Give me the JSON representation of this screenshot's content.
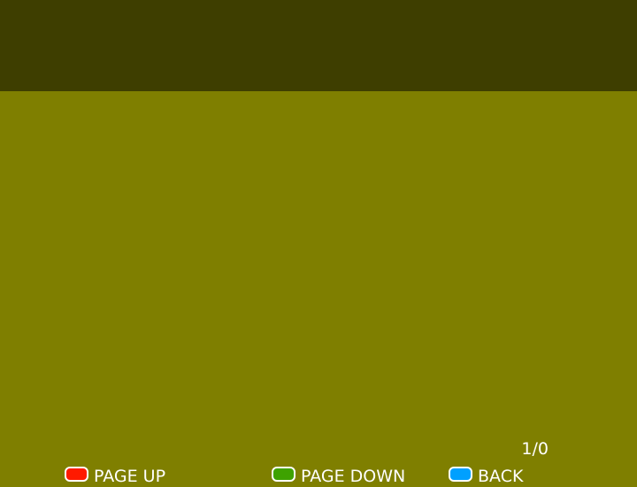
{
  "page_indicator": "1/0",
  "footer": {
    "keys": [
      {
        "label": "PAGE UP",
        "color": "#ff1a00"
      },
      {
        "label": "PAGE DOWN",
        "color": "#3ea200"
      },
      {
        "label": "BACK",
        "color": "#00a0ff"
      }
    ]
  },
  "colors": {
    "background": "#7f7f00",
    "header_bar": "#3e3e00",
    "text": "#ffffff"
  }
}
